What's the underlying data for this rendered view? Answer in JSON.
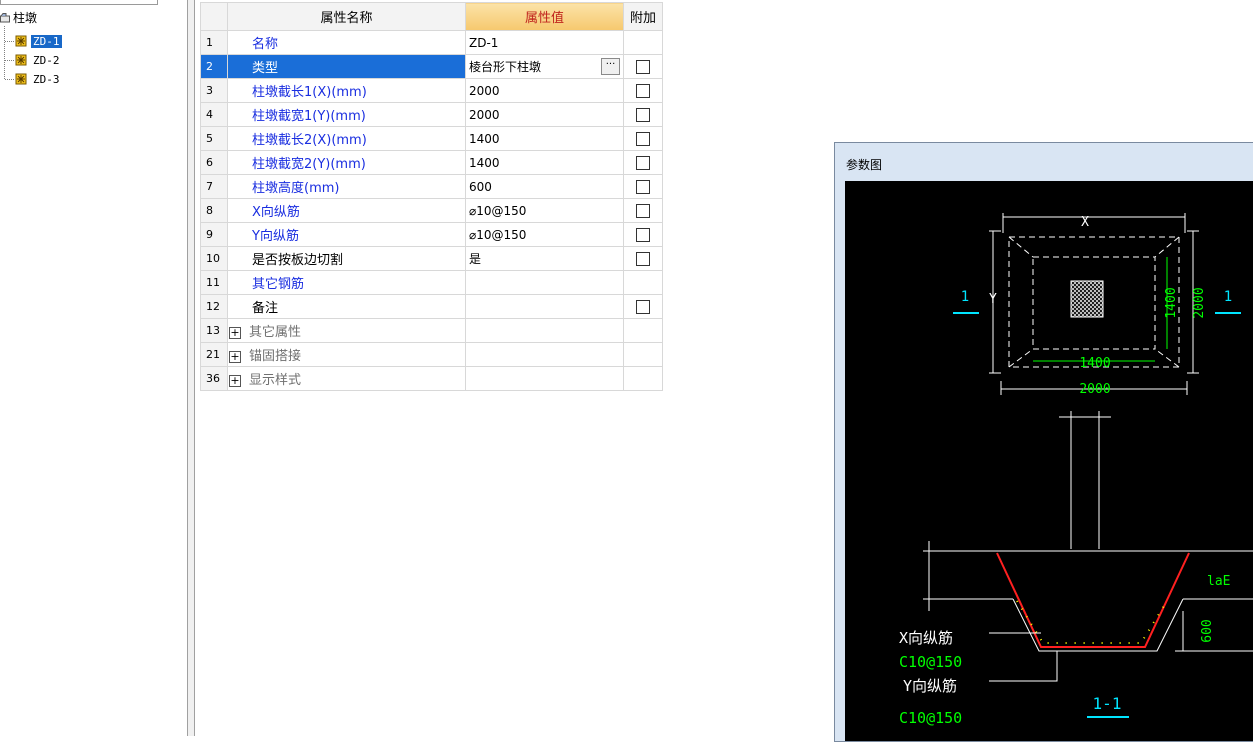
{
  "tree": {
    "root_label": "柱墩",
    "items": [
      "ZD-1",
      "ZD-2",
      "ZD-3"
    ],
    "selected_index": 0
  },
  "grid": {
    "headers": {
      "name": "属性名称",
      "value": "属性值",
      "extra": "附加"
    },
    "rows": [
      {
        "num": "1",
        "name": "名称",
        "value": "ZD-1",
        "check": false
      },
      {
        "num": "2",
        "name": "类型",
        "value": "棱台形下柱墩",
        "check": true
      },
      {
        "num": "3",
        "name": "柱墩截长1(X)(mm)",
        "value": "2000",
        "check": true
      },
      {
        "num": "4",
        "name": "柱墩截宽1(Y)(mm)",
        "value": "2000",
        "check": true
      },
      {
        "num": "5",
        "name": "柱墩截长2(X)(mm)",
        "value": "1400",
        "check": true
      },
      {
        "num": "6",
        "name": "柱墩截宽2(Y)(mm)",
        "value": "1400",
        "check": true
      },
      {
        "num": "7",
        "name": "柱墩高度(mm)",
        "value": "600",
        "check": true
      },
      {
        "num": "8",
        "name": "X向纵筋",
        "value": "⌀10@150",
        "check": true
      },
      {
        "num": "9",
        "name": "Y向纵筋",
        "value": "⌀10@150",
        "check": true
      },
      {
        "num": "10",
        "name": "是否按板边切割",
        "value": "是",
        "check": true
      },
      {
        "num": "11",
        "name": "其它钢筋",
        "value": "",
        "check": false
      },
      {
        "num": "12",
        "name": "备注",
        "value": "",
        "check": true
      },
      {
        "num": "13",
        "name": "其它属性",
        "value": "",
        "check": false
      },
      {
        "num": "21",
        "name": "锚固搭接",
        "value": "",
        "check": false
      },
      {
        "num": "36",
        "name": "显示样式",
        "value": "",
        "check": false
      }
    ],
    "selected_row": "2",
    "ellipsis": "···",
    "plus": "+"
  },
  "diagram": {
    "title": "参数图",
    "labels": {
      "x": "X",
      "y": "Y",
      "dim_1400_v": "1400",
      "dim_2000_v": "2000",
      "dim_1400_h": "1400",
      "dim_2000_h": "2000",
      "sec_left": "1",
      "sec_right": "1",
      "lae": "laE",
      "dim_600": "600",
      "x_rebar": "X向纵筋",
      "x_rebar_spec": "C10@150",
      "y_rebar": "Y向纵筋",
      "y_rebar_spec": "C10@150",
      "section": "1-1"
    },
    "colors": {
      "background": "#000000",
      "line": "#ffffff",
      "dimension": "#00ff00",
      "section": "#00e5ff",
      "rebar": "#ff2020",
      "dots": "#ffff00"
    }
  }
}
